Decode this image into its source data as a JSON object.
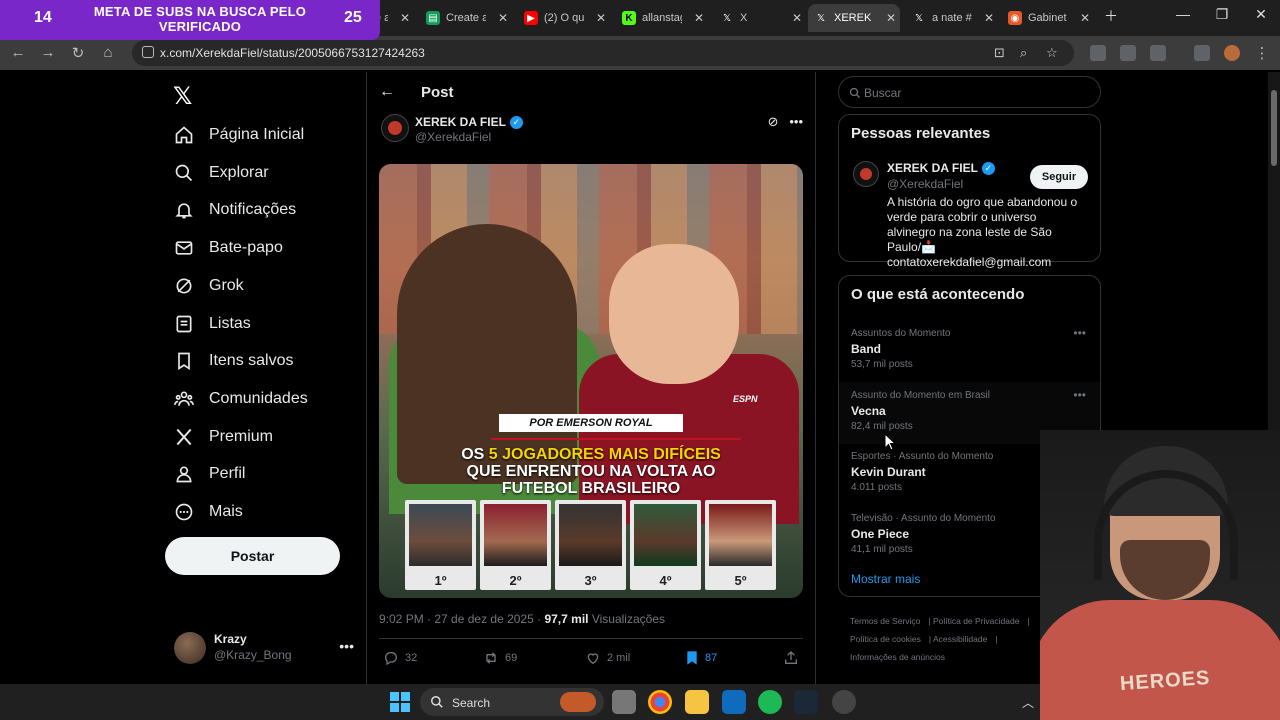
{
  "overlay": {
    "left_count": "14",
    "right_count": "25",
    "title": "META DE SUBS NA BUSCA PELO VERIFICADO"
  },
  "browser": {
    "tabs": [
      {
        "title": "Create a",
        "favicon": "doc-icon"
      },
      {
        "title": "Create a",
        "favicon": "doc-icon"
      },
      {
        "title": "(2) O qu",
        "favicon": "youtube-icon"
      },
      {
        "title": "allanstag",
        "favicon": "k-icon"
      },
      {
        "title": "X",
        "favicon": "x-icon"
      },
      {
        "title": "XEREK D",
        "favicon": "x-icon",
        "active": true
      },
      {
        "title": "a nate #",
        "favicon": "x-icon"
      },
      {
        "title": "Gabinet",
        "favicon": "app-icon"
      }
    ],
    "url": "x.com/XerekdaFiel/status/2005066753127424263"
  },
  "nav": {
    "items": [
      {
        "label": "Página Inicial",
        "icon": "home-icon"
      },
      {
        "label": "Explorar",
        "icon": "search-icon"
      },
      {
        "label": "Notificações",
        "icon": "bell-icon"
      },
      {
        "label": "Bate-papo",
        "icon": "mail-icon"
      },
      {
        "label": "Grok",
        "icon": "grok-icon"
      },
      {
        "label": "Listas",
        "icon": "list-icon"
      },
      {
        "label": "Itens salvos",
        "icon": "bookmark-icon"
      },
      {
        "label": "Comunidades",
        "icon": "people-icon"
      },
      {
        "label": "Premium",
        "icon": "x-icon"
      },
      {
        "label": "Perfil",
        "icon": "person-icon"
      },
      {
        "label": "Mais",
        "icon": "more-circle-icon"
      }
    ],
    "post_button": "Postar",
    "account": {
      "name": "Krazy",
      "handle": "@Krazy_Bong"
    }
  },
  "post": {
    "header": "Post",
    "author": {
      "name": "XEREK DA FIEL",
      "handle": "@XerekdaFiel"
    },
    "image": {
      "caption": "POR EMERSON ROYAL",
      "headline_prefix": "OS",
      "headline_highlight": "5 JOGADORES MAIS DIFÍCEIS",
      "headline_rest": "QUE ENFRENTOU NA VOLTA AO FUTEBOL BRASILEIRO",
      "watermark": "ESPN",
      "ranks": [
        "1º",
        "2º",
        "3º",
        "4º",
        "5º"
      ]
    },
    "time": "9:02 PM · 27 de dez de 2025",
    "views_count": "97,7 mil",
    "views_label": "Visualizações",
    "replies": "32",
    "reposts": "69",
    "likes": "2 mil",
    "bookmarks": "87"
  },
  "right": {
    "search_placeholder": "Buscar",
    "relevant": {
      "title": "Pessoas relevantes",
      "name": "XEREK DA FIEL",
      "handle": "@XerekdaFiel",
      "follow": "Seguir",
      "bio": "A história do ogro que abandonou o verde para cobrir o universo alvinegro na zona leste de São Paulo/📩 contatoxerekdafiel@gmail.com"
    },
    "trending": {
      "title": "O que está acontecendo",
      "items": [
        {
          "context": "Assuntos do Momento",
          "name": "Band",
          "posts": "53,7 mil posts"
        },
        {
          "context": "Assunto do Momento em Brasil",
          "name": "Vecna",
          "posts": "82,4 mil posts"
        },
        {
          "context": "Esportes · Assunto do Momento",
          "name": "Kevin Durant",
          "posts": "4.011 posts"
        },
        {
          "context": "Televisão · Assunto do Momento",
          "name": "One Piece",
          "posts": "41,1 mil posts"
        }
      ],
      "show_more": "Mostrar mais"
    },
    "footer": [
      "Termos de Serviço",
      "Política de Privacidade",
      "Política de cookies",
      "Acessibilidade",
      "Informações de anúncios"
    ]
  },
  "webcam": {
    "shirt_text": "HEROES"
  },
  "taskbar": {
    "search": "Search"
  }
}
